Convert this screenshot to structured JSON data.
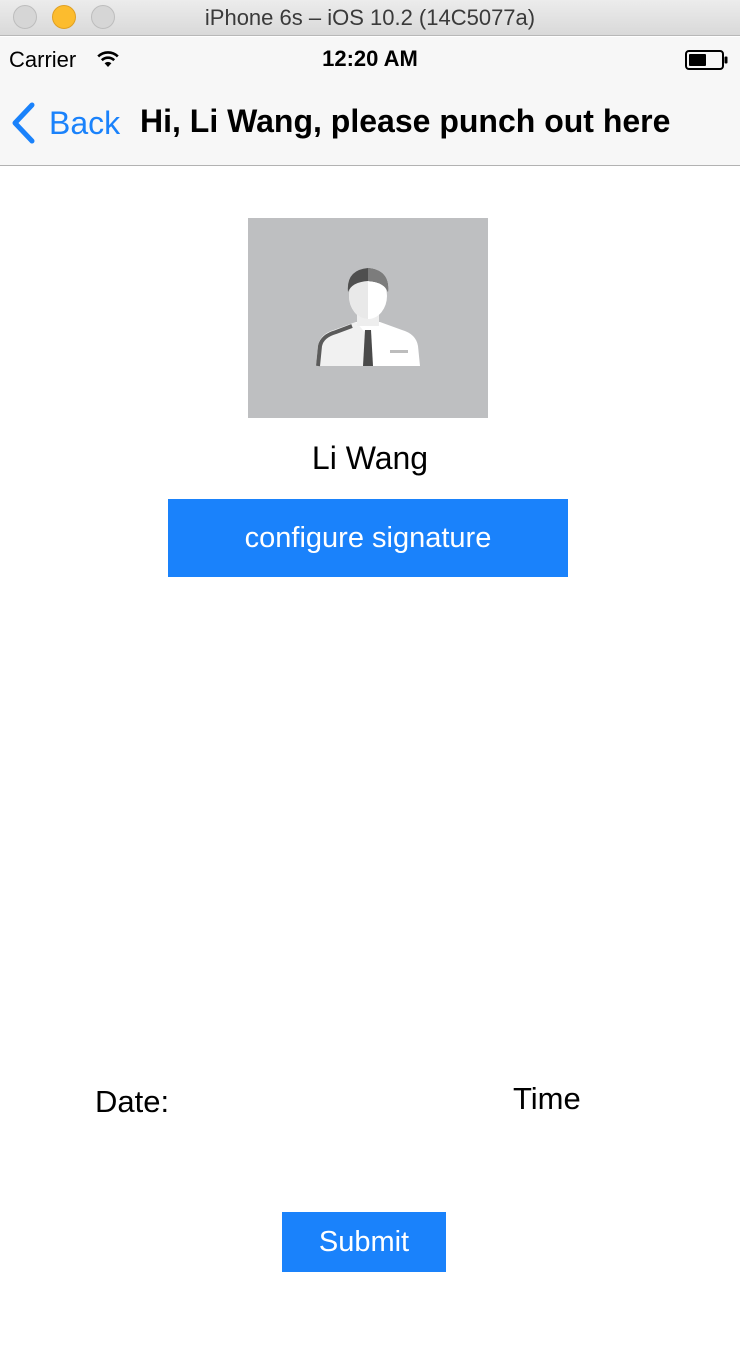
{
  "window": {
    "title": "iPhone 6s – iOS 10.2 (14C5077a)"
  },
  "status_bar": {
    "carrier": "Carrier",
    "time": "12:20 AM",
    "wifi_icon": "wifi-icon",
    "battery_icon": "battery-icon"
  },
  "nav": {
    "back_label": "Back",
    "back_icon": "chevron-left-icon",
    "title": "Hi, Li Wang, please punch out here"
  },
  "profile": {
    "avatar_icon": "person-avatar-icon",
    "name": "Li Wang"
  },
  "actions": {
    "configure_label": "configure signature",
    "submit_label": "Submit"
  },
  "fields": {
    "date_label": "Date:",
    "time_label": "Time"
  },
  "colors": {
    "accent": "#1a82fb",
    "nav_background": "#f7f7f7",
    "avatar_background": "#bebfc1"
  }
}
